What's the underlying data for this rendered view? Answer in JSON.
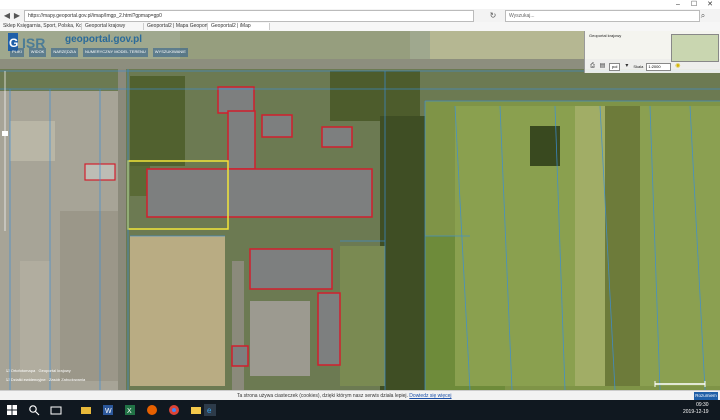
{
  "browser": {
    "window_controls": {
      "minimize": "–",
      "maximize": "☐",
      "close": "✕"
    },
    "address": "https://mapy.geoportal.gov.pl/imap/Imgp_2.html?gpmap=gp0",
    "search_placeholder": "Wyszukaj...",
    "tabs": [
      {
        "label": "Sklep Księgarnia, Sport, Polska, Kozłow..."
      },
      {
        "label": "Geoportal krajowy"
      },
      {
        "label": "Geoportal2 | Mapa Geoportal 2"
      },
      {
        "label": "Geoportal2 | iMap"
      }
    ]
  },
  "map": {
    "portal_name": "geoportal.gov.pl",
    "menu": [
      "PLIKI",
      "WIDOK",
      "NARZĘDZIA",
      "NUMERYCZNY MODEL TERENU",
      "WYSZUKIWANIE"
    ],
    "overview_title": "Geoportal krajowy",
    "unit": "pol",
    "scale_label": "Skala",
    "scale_value": "1:2000",
    "layers": [
      {
        "label": "Ortofotomapa",
        "status": "Geoportal krajowy"
      },
      {
        "label": "Działki ewidencyjne",
        "status": "Zasób Zabudowania"
      }
    ],
    "colors": {
      "building_outline": "#d21f2d",
      "selection_outline": "#f2e63a",
      "parcel_line": "#3a8ed8"
    }
  },
  "cookie": {
    "text": "Ta strona używa ciasteczek (cookies), dzięki którym nasz serwis działa lepiej.",
    "link": "Dowiedz się więcej",
    "button": "Rozumiem"
  },
  "taskbar": {
    "time": "09:30",
    "date": "2019-12-19",
    "apps": [
      "start-icon",
      "search-icon",
      "task-view-icon",
      "explorer-icon",
      "word-icon",
      "excel-icon",
      "firefox-icon",
      "chrome-icon",
      "folder-icon",
      "edge-icon"
    ]
  }
}
